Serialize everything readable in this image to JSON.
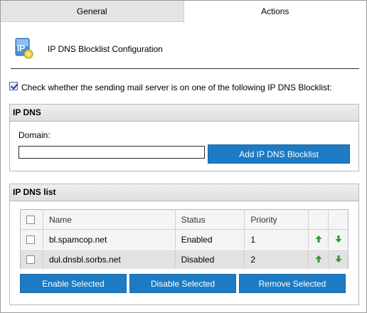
{
  "tabs": [
    {
      "label": "General",
      "active": false
    },
    {
      "label": "Actions",
      "active": true
    }
  ],
  "header": {
    "icon": "ip-address-icon",
    "title": "IP DNS Blocklist Configuration"
  },
  "enable_check": {
    "checked": true,
    "label": "Check whether the sending mail server is on one of the following IP DNS Blocklist:"
  },
  "ip_dns_panel": {
    "title": "IP DNS",
    "domain_label": "Domain:",
    "domain_value": "",
    "add_button": "Add IP DNS Blocklist"
  },
  "list_panel": {
    "title": "IP DNS list",
    "columns": [
      "Name",
      "Status",
      "Priority"
    ],
    "rows": [
      {
        "name": "bl.spamcop.net",
        "status": "Enabled",
        "priority": "1"
      },
      {
        "name": "dul.dnsbl.sorbs.net",
        "status": "Disabled",
        "priority": "2"
      }
    ],
    "buttons": {
      "enable": "Enable Selected",
      "disable": "Disable Selected",
      "remove": "Remove Selected"
    }
  },
  "colors": {
    "button_blue": "#1c7bc3",
    "arrow_green": "#2e9a2e"
  }
}
